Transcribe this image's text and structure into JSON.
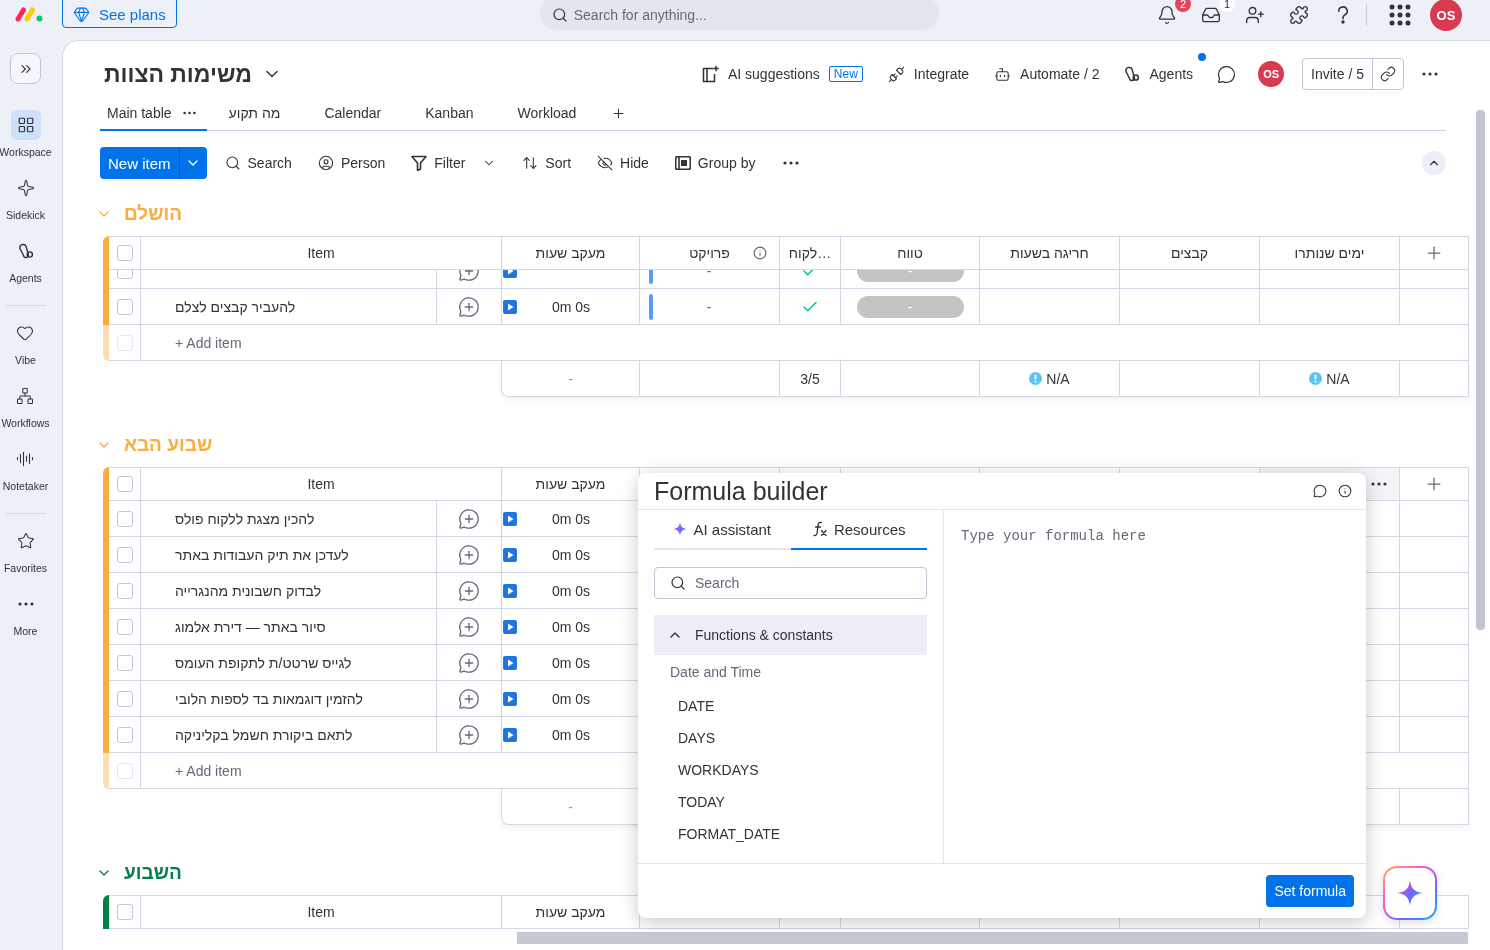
{
  "top_bar": {
    "upgrade": "See plans",
    "search": {
      "placeholder": "Search for anything..."
    },
    "notifications_badge": "2",
    "inbox_badge": "1",
    "avatar": "OS"
  },
  "sidebar": {
    "sections": [
      [
        {
          "label": "Workspace",
          "selected": true
        },
        {
          "label": "Sidekick",
          "selected": false
        },
        {
          "label": "Agents",
          "selected": false
        }
      ],
      [
        {
          "label": "Vibe",
          "selected": false
        },
        {
          "label": "Workflows",
          "selected": false
        },
        {
          "label": "Notetaker",
          "selected": false
        }
      ],
      [
        {
          "label": "Favorites",
          "selected": false
        },
        {
          "label": "More",
          "selected": false
        }
      ]
    ]
  },
  "board": {
    "title": "משימות הצוות",
    "actions": [
      {
        "kind": "ai",
        "label": "AI suggestions",
        "badge": "New"
      },
      {
        "kind": "integrate",
        "label": "Integrate"
      },
      {
        "kind": "automate",
        "label": "Automate / 2"
      },
      {
        "kind": "agents",
        "label": "Agents",
        "notification": true
      }
    ],
    "avatar": "OS",
    "invite": "Invite / 5"
  },
  "views": [
    {
      "label": "Main table",
      "selected": true
    },
    {
      "label": "מה תקוע",
      "selected": false
    },
    {
      "label": "Calendar",
      "selected": false
    },
    {
      "label": "Kanban",
      "selected": false
    },
    {
      "label": "Workload",
      "selected": false
    }
  ],
  "toolbar": {
    "new_item": "New item",
    "tools": [
      {
        "kind": "search",
        "label": "Search"
      },
      {
        "kind": "person",
        "label": "Person"
      },
      {
        "kind": "filter",
        "label": "Filter"
      },
      {
        "kind": "sort",
        "label": "Sort"
      },
      {
        "kind": "hide",
        "label": "Hide"
      },
      {
        "kind": "group",
        "label": "Group by"
      }
    ]
  },
  "groups": [
    {
      "title": "הושלם",
      "color": "#fdab3d",
      "expanded": true,
      "header": {
        "checked": false,
        "item": "Item",
        "time_tracking": "מעקב שעות",
        "project": "פרויקט",
        "client": "לקוח…",
        "timeline": "טווח",
        "overtime": "חריגה בשעות",
        "files": "קבצים",
        "days_left": "ימים שנותרו",
        "add_column": true
      },
      "rows": [
        {
          "kind": "cut",
          "checked": false,
          "project": "-",
          "client_done": true,
          "timeline": "-"
        },
        {
          "kind": "full",
          "checked": false,
          "name": "להעביר קבצים לצלם",
          "time": "0m 0s",
          "project": "-",
          "client_done": true,
          "timeline": "-"
        }
      ],
      "add_item": {
        "placeholder": "+ Add item",
        "checked": false,
        "disabled": true
      },
      "summary": {
        "time": "-",
        "client": "3/5",
        "overtime": "N/A",
        "days_left": "N/A"
      }
    },
    {
      "title": "שבוע הבא",
      "color": "#fdab3d",
      "expanded": true,
      "header": {
        "checked": false,
        "item": "Item",
        "time_tracking": "מעקב שעות",
        "days_left_menu": true,
        "add_column": true
      },
      "rows": [
        {
          "kind": "full",
          "checked": false,
          "name": "להכין מצגת ללקוח פולס",
          "time": "0m 0s"
        },
        {
          "kind": "full",
          "checked": false,
          "name": "לעדכן את תיק העבודות באתר",
          "time": "0m 0s"
        },
        {
          "kind": "full",
          "checked": false,
          "name": "לבדוק חשבונית מהנגרייה",
          "time": "0m 0s"
        },
        {
          "kind": "full",
          "checked": false,
          "name": "סיור באתר — דירת אלמוג",
          "time": "0m 0s"
        },
        {
          "kind": "full",
          "checked": false,
          "name": "לגייס שרטט/ת לתקופת העומס",
          "time": "0m 0s"
        },
        {
          "kind": "full",
          "checked": false,
          "name": "להזמין דוגמאות בד לספות הלובי",
          "time": "0m 0s"
        },
        {
          "kind": "full",
          "checked": false,
          "name": "לתאם ביקורת חשמל בקליניקה",
          "time": "0m 0s"
        }
      ],
      "add_item": {
        "placeholder": "+ Add item",
        "checked": false,
        "disabled": true
      },
      "summary": {
        "time": "-"
      }
    },
    {
      "title": "השבוע",
      "color": "#037f4c",
      "expanded": true,
      "header": {
        "checked": false,
        "item": "Item",
        "time_tracking": "מעקב שעות"
      }
    }
  ],
  "formula_builder": {
    "title": "Formula builder",
    "tabs": [
      {
        "kind": "ai",
        "label": "AI assistant",
        "selected": false
      },
      {
        "kind": "resources",
        "label": "Resources",
        "selected": true
      }
    ],
    "search": {
      "placeholder": "Search"
    },
    "section": {
      "label": "Functions & constants",
      "expanded": true
    },
    "category": "Date and Time",
    "functions": [
      "DATE",
      "DAYS",
      "WORKDAYS",
      "TODAY",
      "FORMAT_DATE"
    ],
    "editor": {
      "placeholder": "Type your formula here"
    },
    "submit": "Set formula"
  }
}
